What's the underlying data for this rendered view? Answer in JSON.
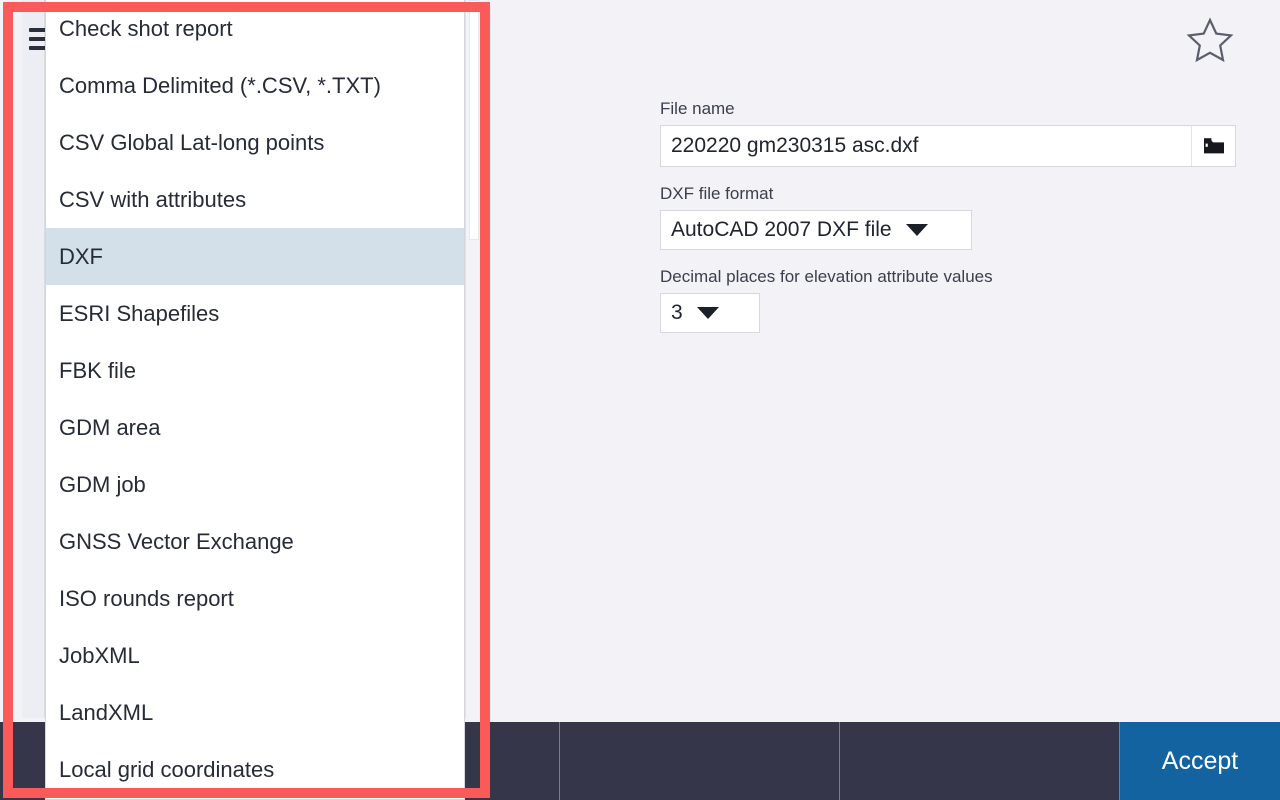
{
  "window": {
    "background_color": "#f2f2f7",
    "highlight_color": "#fa5a5a"
  },
  "toolbar": {
    "menu_icon": "hamburger-icon",
    "favorite_icon": "star-outline-icon"
  },
  "format_popup": {
    "selected": "DXF",
    "selected_bg": "#d3e0ea",
    "items": [
      {
        "label": "Check shot report"
      },
      {
        "label": "Comma Delimited (*.CSV, *.TXT)"
      },
      {
        "label": "CSV Global Lat-long points"
      },
      {
        "label": "CSV with attributes"
      },
      {
        "label": "DXF"
      },
      {
        "label": "ESRI Shapefiles"
      },
      {
        "label": "FBK file"
      },
      {
        "label": "GDM area"
      },
      {
        "label": "GDM job"
      },
      {
        "label": "GNSS Vector Exchange"
      },
      {
        "label": "ISO rounds report"
      },
      {
        "label": "JobXML"
      },
      {
        "label": "LandXML"
      },
      {
        "label": "Local grid coordinates"
      }
    ]
  },
  "settings": {
    "file_name": {
      "label": "File name",
      "value": "220220 gm230315 asc.dxf",
      "placeholder": "Enter file name",
      "browse_icon": "folder-icon"
    },
    "dxf_file_format": {
      "label": "DXF file format",
      "value": "AutoCAD 2007 DXF file"
    },
    "decimal_places": {
      "label": "Decimal places for elevation attribute values",
      "value": "3"
    }
  },
  "bottom_bar": {
    "background_color": "#35364a",
    "cells": [
      "",
      "",
      "",
      ""
    ],
    "accept_label": "Accept",
    "accept_color": "#12639f"
  }
}
